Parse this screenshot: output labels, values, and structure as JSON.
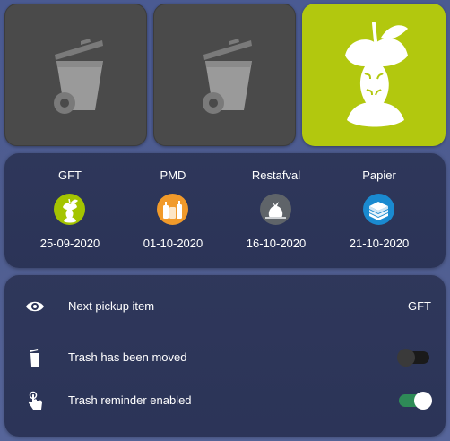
{
  "tiles": [
    {
      "name": "trash-bin-tile-1",
      "icon": "trash-bin-icon",
      "color": "#4a4a4a"
    },
    {
      "name": "trash-bin-tile-2",
      "icon": "trash-bin-icon",
      "color": "#4a4a4a"
    },
    {
      "name": "gft-tile",
      "icon": "apple-core-icon",
      "color": "#b2c80e"
    }
  ],
  "schedule": [
    {
      "label": "GFT",
      "date": "25-09-2020",
      "icon": "apple-core-icon",
      "color": "#a4c400"
    },
    {
      "label": "PMD",
      "date": "01-10-2020",
      "icon": "bottles-icon",
      "color": "#f19a2a"
    },
    {
      "label": "Restafval",
      "date": "16-10-2020",
      "icon": "garbage-bag-icon",
      "color": "#5f6469"
    },
    {
      "label": "Papier",
      "date": "21-10-2020",
      "icon": "paper-stack-icon",
      "color": "#1a8ad0"
    }
  ],
  "entities": {
    "next_pickup": {
      "label": "Next pickup item",
      "value": "GFT",
      "icon": "eye-icon"
    },
    "trash_moved": {
      "label": "Trash has been moved",
      "state": "off",
      "icon": "trash-can-icon"
    },
    "reminder": {
      "label": "Trash reminder enabled",
      "state": "on",
      "icon": "gesture-tap-icon"
    }
  }
}
